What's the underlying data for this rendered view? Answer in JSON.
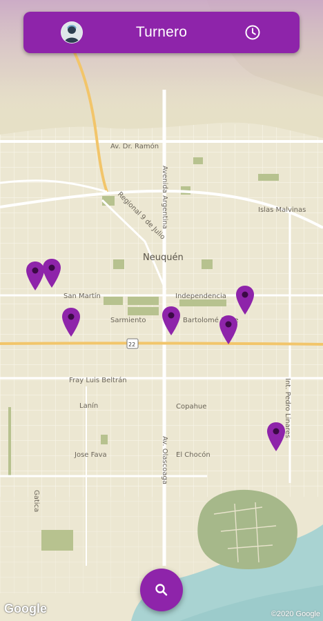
{
  "app": {
    "title": "Turnero",
    "accent_color": "#8e24aa",
    "avatar_icon": "user-avatar",
    "history_icon": "clock-icon",
    "search_icon": "search-icon"
  },
  "map": {
    "city_label": "Neuquén",
    "street_labels": [
      "Av. Dr. Ramón",
      "Avenida Argentina",
      "Regional 9 de Julio",
      "Islas Malvinas",
      "San Martín",
      "Independencia",
      "Sarmiento",
      "Bartolomé Mitre",
      "22",
      "Fray Luis Beltrán",
      "Lanín",
      "Copahue",
      "Int. Pedro Linares",
      "Jose Fava",
      "El Chocón",
      "Av. Olascoaga",
      "Gatica"
    ],
    "markers_count": 8,
    "attribution_logo": "Google",
    "attribution_copy": "©2020 Google"
  }
}
